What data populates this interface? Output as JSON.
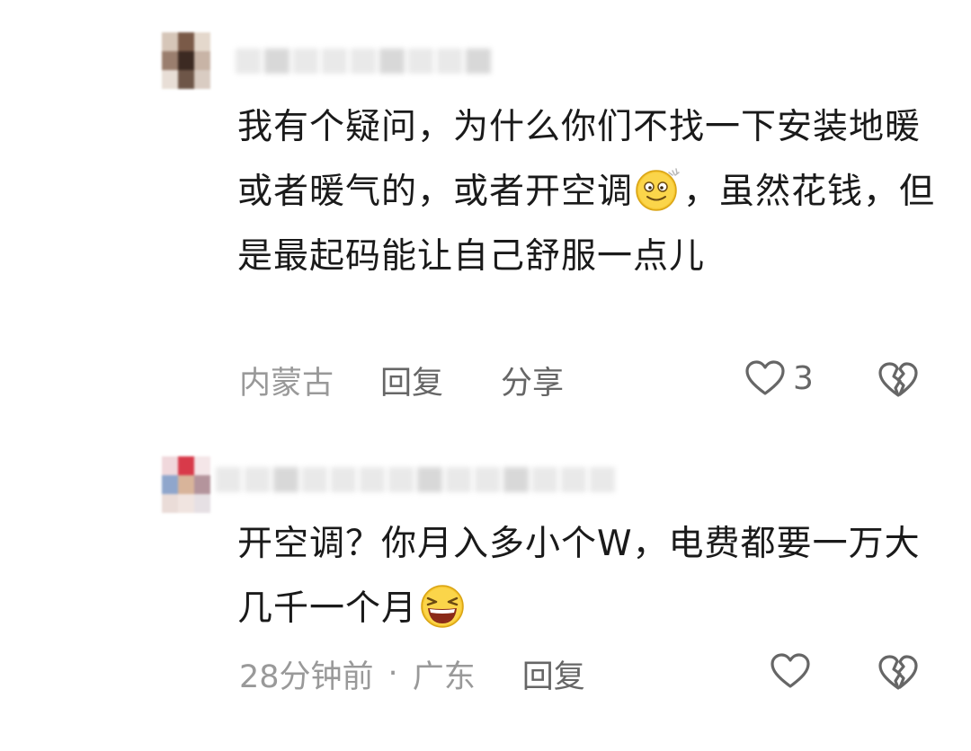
{
  "comments": [
    {
      "avatar_colors": [
        "#d6c6b8",
        "#7a5a48",
        "#e4d8cc",
        "#9a7e6e",
        "#3c2a22",
        "#c8b4a6",
        "#e8ded6",
        "#6e5648",
        "#d9ccc2"
      ],
      "text_parts": [
        "我有个疑问，为什么你们不找一下安装地暖或者暖气的，或者开空调",
        "，虽然花钱，但是最起码能让自己舒服一点儿"
      ],
      "emoji": "dizzy-smile-emoji",
      "location": "内蒙古",
      "reply_label": "回复",
      "share_label": "分享",
      "like_count": "3"
    },
    {
      "avatar_colors": [
        "#f0d8dc",
        "#d83a4a",
        "#f4e6e8",
        "#8fa6cc",
        "#d8b49a",
        "#b4949c",
        "#eadcd8",
        "#f0e4e0",
        "#e6e0e4"
      ],
      "text_parts": [
        "开空调？你月入多小个W，电费都要一万大几千一个月",
        ""
      ],
      "emoji": "laughing-emoji",
      "time": "28分钟前",
      "dot": "·",
      "location": "广东",
      "reply_label": "回复"
    }
  ],
  "colors": {
    "text_primary": "#1a1a1a",
    "text_secondary": "#999999",
    "action_text": "#666666",
    "emoji_yellow": "#f6c630"
  }
}
